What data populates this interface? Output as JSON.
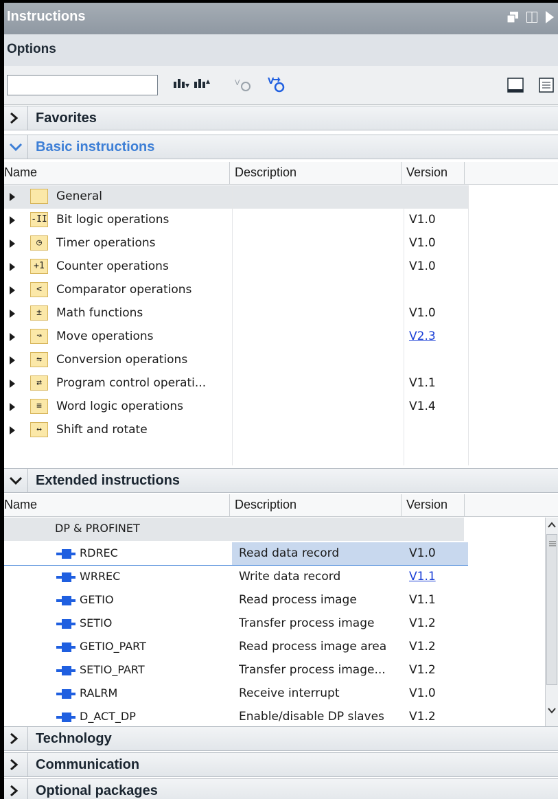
{
  "title": "Instructions",
  "options_label": "Options",
  "search": {
    "value": "",
    "placeholder": ""
  },
  "sections": {
    "favorites": "Favorites",
    "basic": "Basic instructions",
    "extended": "Extended instructions",
    "technology": "Technology",
    "communication": "Communication",
    "optional": "Optional packages"
  },
  "columns": {
    "name": "Name",
    "description": "Description",
    "version": "Version"
  },
  "basic_rows": [
    {
      "name": "General",
      "icon": "folder-icon",
      "glyph": "",
      "version": "",
      "link": false
    },
    {
      "name": "Bit logic operations",
      "icon": "bit-logic-icon",
      "glyph": "-II",
      "version": "V1.0",
      "link": false
    },
    {
      "name": "Timer operations",
      "icon": "timer-icon",
      "glyph": "◷",
      "version": "V1.0",
      "link": false
    },
    {
      "name": "Counter operations",
      "icon": "counter-icon",
      "glyph": "+1",
      "version": "V1.0",
      "link": false
    },
    {
      "name": "Comparator operations",
      "icon": "comparator-icon",
      "glyph": "<",
      "version": "",
      "link": false
    },
    {
      "name": "Math functions",
      "icon": "math-icon",
      "glyph": "±",
      "version": "V1.0",
      "link": false
    },
    {
      "name": "Move operations",
      "icon": "move-icon",
      "glyph": "↝",
      "version": "V2.3",
      "link": true
    },
    {
      "name": "Conversion operations",
      "icon": "conversion-icon",
      "glyph": "⇋",
      "version": "",
      "link": false
    },
    {
      "name": "Program control operati...",
      "icon": "program-control-icon",
      "glyph": "⇄",
      "version": "V1.1",
      "link": false
    },
    {
      "name": "Word logic operations",
      "icon": "word-logic-icon",
      "glyph": "≡",
      "version": "V1.4",
      "link": false
    },
    {
      "name": "Shift and rotate",
      "icon": "shift-rotate-icon",
      "glyph": "↔",
      "version": "",
      "link": false
    }
  ],
  "extended_group": "DP & PROFINET",
  "extended_rows": [
    {
      "name": "RDREC",
      "description": "Read data record",
      "version": "V1.0",
      "link": false,
      "selected": true
    },
    {
      "name": "WRREC",
      "description": "Write data record",
      "version": "V1.1",
      "link": true,
      "selected": false
    },
    {
      "name": "GETIO",
      "description": "Read process image",
      "version": "V1.1",
      "link": false,
      "selected": false
    },
    {
      "name": "SETIO",
      "description": "Transfer process image",
      "version": "V1.2",
      "link": false,
      "selected": false
    },
    {
      "name": "GETIO_PART",
      "description": "Read process image area",
      "version": "V1.2",
      "link": false,
      "selected": false
    },
    {
      "name": "SETIO_PART",
      "description": "Transfer process image...",
      "version": "V1.2",
      "link": false,
      "selected": false
    },
    {
      "name": "RALRM",
      "description": "Receive interrupt",
      "version": "V1.0",
      "link": false,
      "selected": false
    },
    {
      "name": "D_ACT_DP",
      "description": "Enable/disable DP slaves",
      "version": "V1.2",
      "link": false,
      "selected": false
    }
  ],
  "colors": {
    "accent": "#3d7fd6",
    "link": "#1a3fd6",
    "selection": "#c8d8ee",
    "block": "#1f5fe0"
  }
}
